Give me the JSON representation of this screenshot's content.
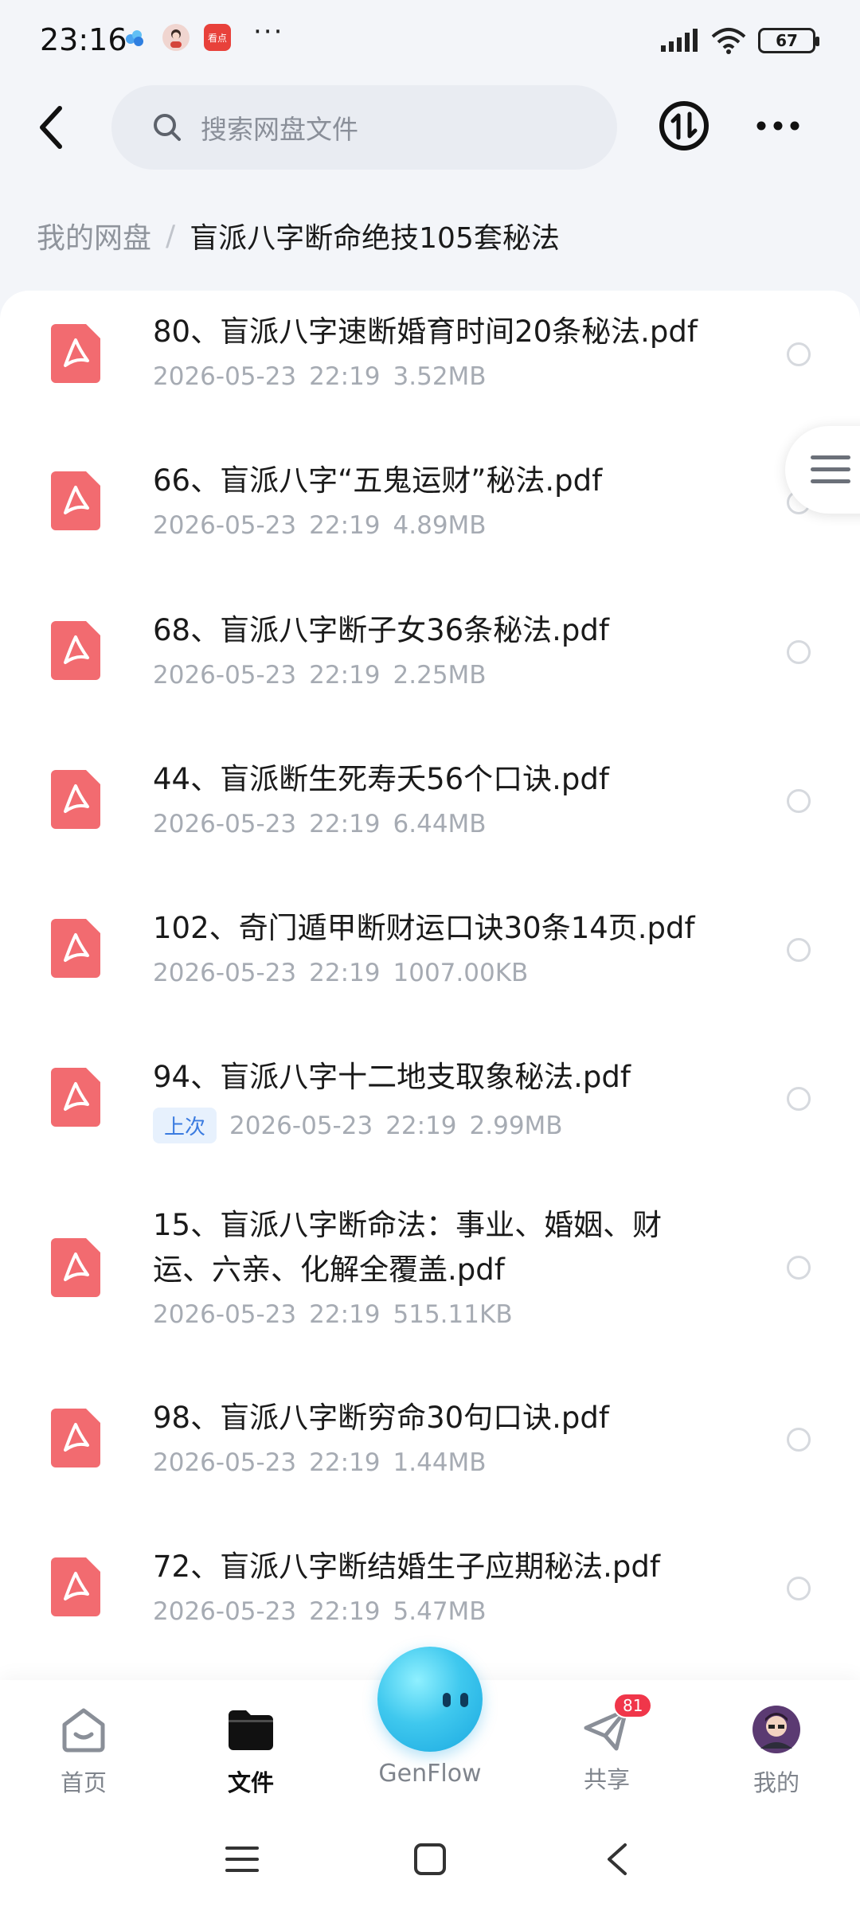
{
  "status_bar": {
    "time": "23:16",
    "news_app_label": "看点",
    "battery": "67"
  },
  "header": {
    "search_placeholder": "搜索网盘文件"
  },
  "breadcrumb": {
    "root": "我的网盘",
    "separator": "/",
    "current": "盲派八字断命绝技105套秘法"
  },
  "files": [
    {
      "name": "80、盲派八字速断婚育时间20条秘法.pdf",
      "date": "2026-05-23",
      "time": "22:19",
      "size": "3.52MB"
    },
    {
      "name": "66、盲派八字“五鬼运财”秘法.pdf",
      "date": "2026-05-23",
      "time": "22:19",
      "size": "4.89MB"
    },
    {
      "name": "68、盲派八字断子女36条秘法.pdf",
      "date": "2026-05-23",
      "time": "22:19",
      "size": "2.25MB"
    },
    {
      "name": "44、盲派断生死寿夭56个口诀.pdf",
      "date": "2026-05-23",
      "time": "22:19",
      "size": "6.44MB"
    },
    {
      "name": "102、奇门遁甲断财运口诀30条14页.pdf",
      "date": "2026-05-23",
      "time": "22:19",
      "size": "1007.00KB"
    },
    {
      "name": "94、盲派八字十二地支取象秘法.pdf",
      "tag": "上次",
      "date": "2026-05-23",
      "time": "22:19",
      "size": "2.99MB"
    },
    {
      "name_line1": "15、盲派八字断命法：事业、婚姻、财",
      "name_line2": "运、六亲、化解全覆盖.pdf",
      "date": "2026-05-23",
      "time": "22:19",
      "size": "515.11KB"
    },
    {
      "name": "98、盲派八字断穷命30句口诀.pdf",
      "date": "2026-05-23",
      "time": "22:19",
      "size": "1.44MB"
    },
    {
      "name": "72、盲派八字断结婚生子应期秘法.pdf",
      "date": "2026-05-23",
      "time": "22:19",
      "size": "5.47MB"
    }
  ],
  "bottom_nav": {
    "home": "首页",
    "files": "文件",
    "genflow": "GenFlow",
    "share": "共享",
    "share_badge": "81",
    "me": "我的"
  },
  "colors": {
    "pdf_icon": "#f26b70",
    "accent": "#3a7be0",
    "badge": "#f0364a"
  },
  "icons": [
    "back-icon",
    "search-icon",
    "sort-icon",
    "more-icon",
    "pdf-icon",
    "menu-icon",
    "home-icon",
    "folder-icon",
    "share-icon",
    "avatar-icon"
  ]
}
